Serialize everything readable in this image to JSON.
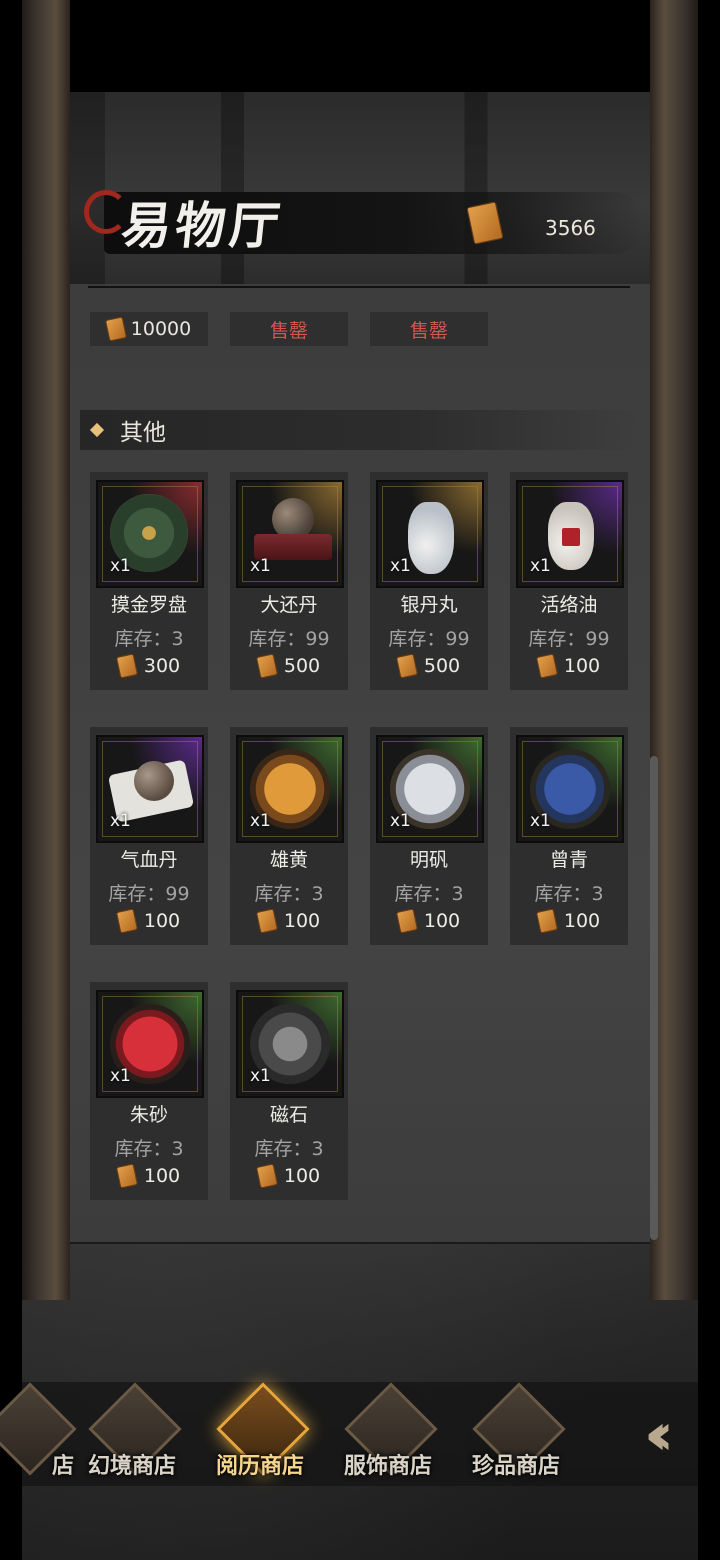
{
  "header": {
    "title": "易物厅",
    "currency_value": "3566"
  },
  "top_row": [
    {
      "price": "10000"
    },
    {
      "status": "售罄"
    },
    {
      "status": "售罄"
    }
  ],
  "section": {
    "title": "其他"
  },
  "items": [
    {
      "name": "摸金罗盘",
      "qty": "x1",
      "stock": "库存：3",
      "price": "300",
      "rarity_color": "#8a2a30"
    },
    {
      "name": "大还丹",
      "qty": "x1",
      "stock": "库存：99",
      "price": "500",
      "rarity_color": "#8a6a30"
    },
    {
      "name": "银丹丸",
      "qty": "x1",
      "stock": "库存：99",
      "price": "500",
      "rarity_color": "#8a6a30"
    },
    {
      "name": "活络油",
      "qty": "x1",
      "stock": "库存：99",
      "price": "100",
      "rarity_color": "#5a2a8a"
    },
    {
      "name": "气血丹",
      "qty": "x1",
      "stock": "库存：99",
      "price": "100",
      "rarity_color": "#5a2a8a"
    },
    {
      "name": "雄黄",
      "qty": "x1",
      "stock": "库存：3",
      "price": "100",
      "rarity_color": "#3e6a30"
    },
    {
      "name": "明矾",
      "qty": "x1",
      "stock": "库存：3",
      "price": "100",
      "rarity_color": "#3e6a30"
    },
    {
      "name": "曾青",
      "qty": "x1",
      "stock": "库存：3",
      "price": "100",
      "rarity_color": "#3e6a30"
    },
    {
      "name": "朱砂",
      "qty": "x1",
      "stock": "库存：3",
      "price": "100",
      "rarity_color": "#3e6a30"
    },
    {
      "name": "磁石",
      "qty": "x1",
      "stock": "库存：3",
      "price": "100",
      "rarity_color": "#3e6a30"
    }
  ],
  "bottom_nav": {
    "tabs": [
      {
        "label": "店",
        "active": false
      },
      {
        "label": "幻境商店",
        "active": false
      },
      {
        "label": "阅历商店",
        "active": true
      },
      {
        "label": "服饰商店",
        "active": false
      },
      {
        "label": "珍品商店",
        "active": false
      }
    ],
    "collapse_icon": "double-chevron-left-icon"
  }
}
